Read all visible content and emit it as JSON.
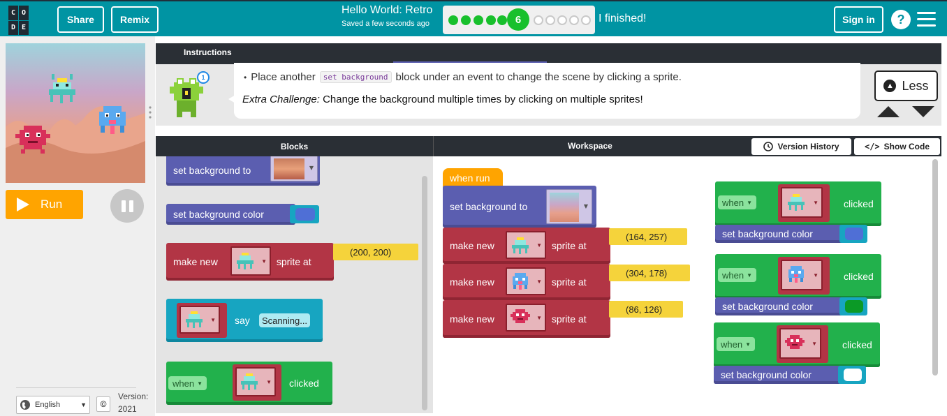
{
  "header": {
    "logo_letters": [
      "C",
      "O",
      "",
      "D",
      "E",
      ""
    ],
    "share_label": "Share",
    "remix_label": "Remix",
    "title": "Hello World: Retro",
    "saved": "Saved a few seconds ago",
    "current_level": "6",
    "finished_label": "I finished!",
    "signin_label": "Sign in",
    "help_label": "?",
    "progress": {
      "completed_before": 5,
      "current": 6,
      "remaining_after": 5
    }
  },
  "left": {
    "run_label": "Run",
    "language": "English",
    "copyright": "©",
    "version_label": "Version:",
    "version_value": "2021"
  },
  "instructions": {
    "tab_label": "Instructions",
    "badge_count": "1",
    "line1_pre": "Place another",
    "line1_code": "set background",
    "line1_post": "block under an event to change the scene by clicking a sprite.",
    "line2_em": "Extra Challenge:",
    "line2_rest": "Change the background multiple times by clicking on multiple sprites!",
    "less_label": "Less"
  },
  "toolbox": {
    "header": "Blocks",
    "blocks": {
      "set_bg": "set background to",
      "set_bg_color": "set background color",
      "make_new": "make new",
      "sprite_at": "sprite at",
      "make_coords": "(200, 200)",
      "say": "say",
      "say_text": "Scanning...",
      "when": "when",
      "clicked": "clicked"
    }
  },
  "workspace": {
    "header": "Workspace",
    "version_history": "Version History",
    "show_code": "Show Code",
    "when_run": "when run",
    "set_bg": "set background to",
    "make_new": "make new",
    "sprite_at": "sprite at",
    "coords": [
      "(164, 257)",
      "(304, 178)",
      "(86, 126)"
    ],
    "when": "when",
    "clicked": "clicked",
    "set_bg_color": "set background color"
  },
  "colors": {
    "header_bg": "#0094a3",
    "run_orange": "#ffa400",
    "progress_green": "#18c02c",
    "purple_block": "#5b5eb0",
    "red_block": "#b23545",
    "green_block": "#22b14c",
    "teal_block": "#17a5c1",
    "swatch_blue": "#4f6fd6",
    "swatch_green": "#0b9a26",
    "swatch_white": "#ffffff"
  }
}
